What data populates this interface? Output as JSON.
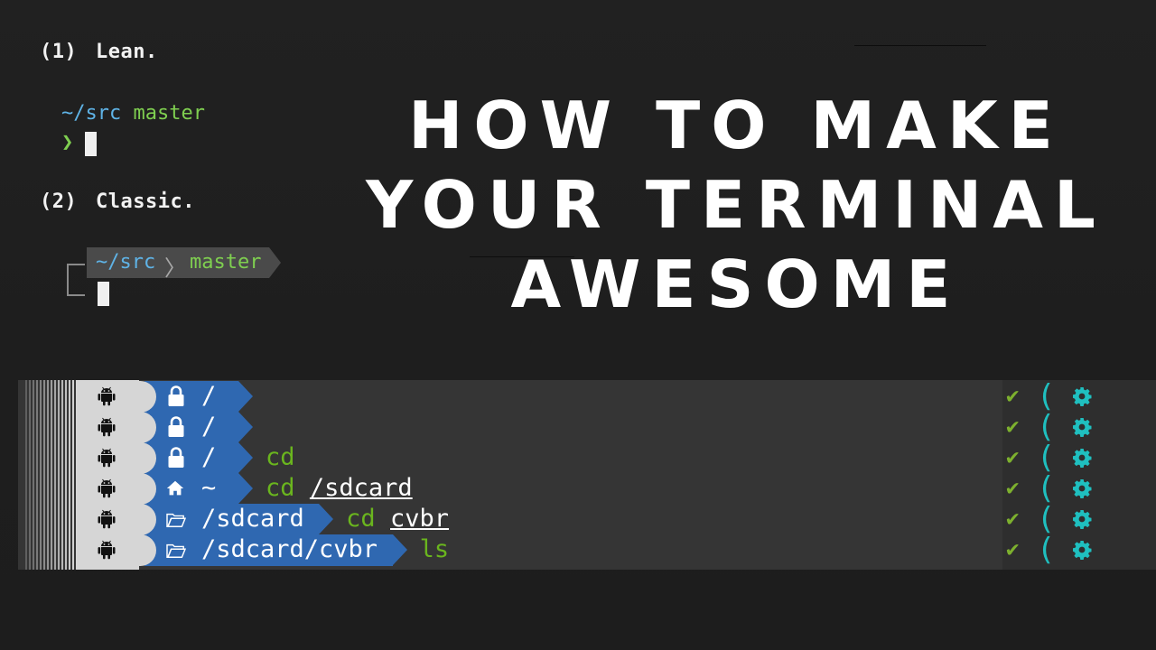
{
  "themes": {
    "lean": {
      "number": "(1)",
      "label": "Lean.",
      "path": "~/src",
      "branch": "master",
      "prompt_symbol": "❯"
    },
    "classic": {
      "number": "(2)",
      "label": "Classic.",
      "path": "~/src",
      "separator": "〉",
      "branch": "master"
    }
  },
  "headline": {
    "line1": "HOW TO MAKE",
    "line2": "YOUR TERMINAL",
    "line3": "AWESOME"
  },
  "terminal": {
    "rows": [
      {
        "icon": "lock-icon",
        "path": "/",
        "command": "",
        "argument": ""
      },
      {
        "icon": "lock-icon",
        "path": "/",
        "command": "",
        "argument": ""
      },
      {
        "icon": "lock-icon",
        "path": "/",
        "command": "cd",
        "argument": ""
      },
      {
        "icon": "home-icon",
        "path": "~",
        "command": "cd",
        "argument": "/sdcard"
      },
      {
        "icon": "folder-icon",
        "path": "/sdcard",
        "command": "cd",
        "argument": "cvbr"
      },
      {
        "icon": "folder-icon",
        "path": "/sdcard/cvbr",
        "command": "ls",
        "argument": ""
      }
    ],
    "status_check": "✔",
    "status_paren": "(",
    "colors": {
      "segment_blue": "#2f68b1",
      "command_green": "#6ab51e",
      "check_green": "#7db02e",
      "gear_teal": "#1fbfbf"
    }
  }
}
